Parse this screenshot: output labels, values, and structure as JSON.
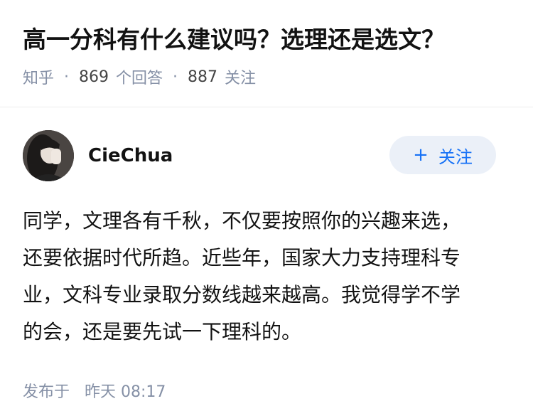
{
  "question": {
    "title": "高一分科有什么建议吗？选理还是选文？",
    "source": "知乎",
    "answer_count": "869",
    "answer_label": "个回答",
    "follower_count": "887",
    "follower_label": "关注"
  },
  "answer": {
    "author_name": "CieChua",
    "follow_label": "关注",
    "content_lines": [
      "同学，文理各有千秋，不仅要按照你的兴趣来选，",
      "还要依据时代所趋。近些年，国家大力支持理科专",
      "业，文科专业录取分数线越来越高。我觉得学不学",
      "的会，还是要先试一下理科的。"
    ],
    "published_label": "发布于",
    "published_time": "昨天 08:17"
  },
  "icons": {
    "follow": "plus-icon",
    "avatar": "user-avatar"
  },
  "colors": {
    "accent": "#1772f6",
    "meta": "#8590a6",
    "follow_bg": "#ebf0f8"
  }
}
